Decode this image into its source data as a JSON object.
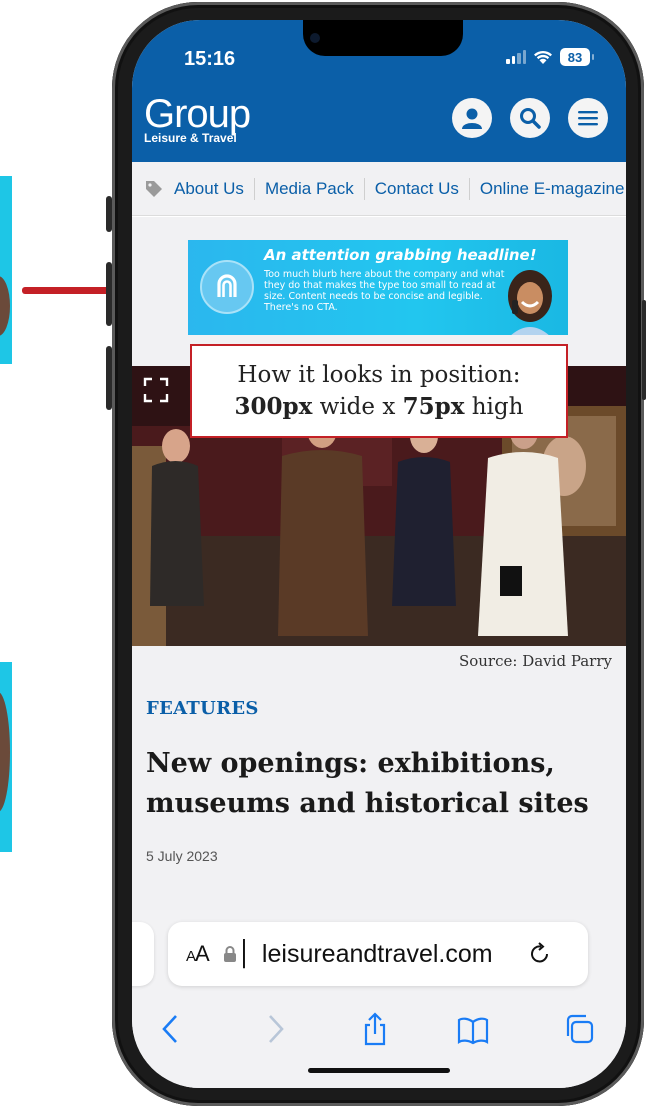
{
  "status": {
    "time": "15:16",
    "battery": "83"
  },
  "header": {
    "logo_main": "Group",
    "logo_sub": "Leisure & Travel"
  },
  "nav": {
    "items": [
      "About Us",
      "Media Pack",
      "Contact Us",
      "Online E-magazine"
    ]
  },
  "ad": {
    "headline": "An attention grabbing headline!",
    "body": "Too much blurb here about the company and what they do that makes the type too small to read at size. Content needs to be concise and legible. There's no CTA."
  },
  "callout": {
    "line1": "How it looks in position:",
    "width_value": "300px",
    "width_text": " wide x ",
    "height_value": "75px",
    "height_text": " high"
  },
  "photo": {
    "credit": "Source: David Parry"
  },
  "article": {
    "section": "FEATURES",
    "headline": "New openings: exhibitions, museums and historical sites",
    "date": "5 July 2023"
  },
  "browser": {
    "aa_large": "A",
    "aa_small": "A",
    "url": "▏leisureandtravel.com"
  },
  "colors": {
    "brand_blue": "#0b5fa8",
    "callout_red": "#c42026",
    "ad_cyan": "#22c6ef"
  }
}
